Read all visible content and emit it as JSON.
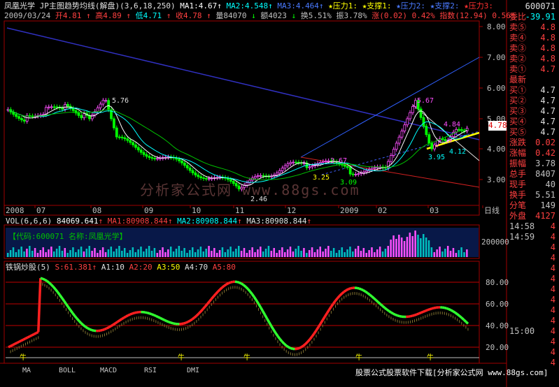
{
  "stock": {
    "name": "凤凰光学",
    "code": "600071",
    "indicator": "JP主图趋势均线(解盘)",
    "params": "(3,6,18,250)"
  },
  "ma_line": [
    {
      "label": "MA1:4.67",
      "arrow": "↑",
      "color": "#ffffff"
    },
    {
      "label": "MA2:4.548",
      "arrow": "↑",
      "color": "#00ffff"
    },
    {
      "label": "MA3:4.464",
      "arrow": "↑",
      "color": "#4a7aff"
    },
    {
      "label": "压力1:",
      "color": "#ffff00",
      "star": true
    },
    {
      "label": "支撑1:",
      "color": "#ffff00",
      "star": true
    },
    {
      "label": "压力2:",
      "color": "#4a7aff",
      "star": true
    },
    {
      "label": "支撑2:",
      "color": "#4a7aff",
      "star": true
    },
    {
      "label": "压力3:",
      "color": "#ff3030",
      "star": true
    }
  ],
  "quote_line": [
    {
      "label": "2009/03/24",
      "color": "#c0c0c0"
    },
    {
      "label": "开4.81",
      "color": "#ff4040"
    },
    {
      "label": "↑",
      "color": "#ff4040"
    },
    {
      "label": "高4.89",
      "color": "#ff4040"
    },
    {
      "label": "↑",
      "color": "#ff4040"
    },
    {
      "label": "低4.71",
      "color": "#00ffff"
    },
    {
      "label": "↑",
      "color": "#ff4040"
    },
    {
      "label": "收4.78",
      "color": "#ff4040"
    },
    {
      "label": "↑",
      "color": "#ff4040"
    },
    {
      "label": "量84070",
      "color": "#c0c0c0"
    },
    {
      "label": "↓",
      "color": "#00ff00"
    },
    {
      "label": "额4023",
      "color": "#c0c0c0"
    },
    {
      "label": "↓",
      "color": "#00ff00"
    },
    {
      "label": "换5.51%",
      "color": "#c0c0c0"
    },
    {
      "label": "振3.78%",
      "color": "#c0c0c0"
    },
    {
      "label": "涨(0.02)",
      "color": "#ff4040"
    },
    {
      "label": "0.42%",
      "color": "#ff4040"
    },
    {
      "label": "指数(12.94)",
      "color": "#ff4040"
    },
    {
      "label": "0.56%",
      "color": "#ff4040"
    }
  ],
  "price_axis": [
    "8.00",
    "7.00",
    "6.00",
    "5.00",
    "4.00",
    "3.00"
  ],
  "price_markers": {
    "high": "5.76",
    "low": "2.46",
    "m1": "3.67",
    "m2": "3.25",
    "m3": "3.09",
    "peak": "5.67",
    "m4": "4.84",
    "m5": "4.12",
    "m6": "3.95"
  },
  "current_price": "4.78",
  "date_axis": [
    "2008",
    "07",
    "08",
    "09",
    "10",
    "11",
    "12",
    "2009",
    "02",
    "03",
    "日线"
  ],
  "vol": {
    "header": "VOL(6,6,6)",
    "v": "84069.641",
    "ma1": "MA1:80908.844",
    "ma2": "MA2:80908.844",
    "ma3": "MA3:80908.844",
    "arrow": "↑",
    "info": "【代码:600071 名称:凤凰光学】",
    "axis": "200000"
  },
  "osc": {
    "name": "铁锅炒股(5)",
    "s": "S:61.381",
    "a1": "A1:10",
    "a2": "A2:20",
    "a3": "A3:50",
    "a4": "A4:70",
    "a5": "A5:80",
    "arrow": "↑",
    "axis": [
      "80.00",
      "60.00",
      "40.00",
      "20.00"
    ],
    "marker": "牛"
  },
  "tabs": [
    "MA",
    "BOLL",
    "MACD",
    "RSI",
    "DMI"
  ],
  "watermark": "分析家公式网 www.88gs.com",
  "footer": "股票公式股票软件下载[分析家公式网 www.88gs.com]",
  "right_panel": {
    "code": "600071",
    "wei_bi_label": "委比",
    "wei_bi": "-39.91",
    "sells": [
      {
        "label": "卖⑤",
        "price": "4.8"
      },
      {
        "label": "卖④",
        "price": "4.8"
      },
      {
        "label": "卖③",
        "price": "4.8"
      },
      {
        "label": "卖②",
        "price": "4.8"
      },
      {
        "label": "卖①",
        "price": "4.7"
      }
    ],
    "latest_label": "最新",
    "buys": [
      {
        "label": "买①",
        "price": "4.7"
      },
      {
        "label": "买②",
        "price": "4.7"
      },
      {
        "label": "买③",
        "price": "4.7"
      },
      {
        "label": "买④",
        "price": "4.7"
      },
      {
        "label": "买⑤",
        "price": "4.7"
      }
    ],
    "stats": [
      {
        "label": "涨跌",
        "value": "0.02",
        "color": "#ff4040"
      },
      {
        "label": "涨幅",
        "value": "0.42",
        "color": "#ff4040"
      },
      {
        "label": "振幅",
        "value": "3.78",
        "color": "#c0c0c0"
      },
      {
        "label": "总手",
        "value": "8407",
        "color": "#c0c0c0"
      },
      {
        "label": "现手",
        "value": "40",
        "color": "#c0c0c0"
      },
      {
        "label": "换手",
        "value": "5.51",
        "color": "#c0c0c0"
      },
      {
        "label": "分笔",
        "value": "149",
        "color": "#c0c0c0"
      }
    ],
    "waipan_label": "外盘",
    "waipan": "4127",
    "ticks": [
      {
        "time": "14:58",
        "vol": "4"
      },
      {
        "time": "14:59",
        "vol": "4"
      },
      {
        "time": "",
        "vol": "4"
      },
      {
        "time": "",
        "vol": "4"
      },
      {
        "time": "",
        "vol": "4"
      },
      {
        "time": "",
        "vol": "4"
      },
      {
        "time": "",
        "vol": "4"
      },
      {
        "time": "",
        "vol": "4"
      },
      {
        "time": "",
        "vol": "4"
      },
      {
        "time": "",
        "vol": "4"
      },
      {
        "time": "15:00",
        "vol": "4"
      },
      {
        "time": "",
        "vol": "4"
      },
      {
        "time": "",
        "vol": "4"
      },
      {
        "time": "",
        "vol": "4"
      },
      {
        "time": "",
        "vol": "4"
      }
    ]
  }
}
